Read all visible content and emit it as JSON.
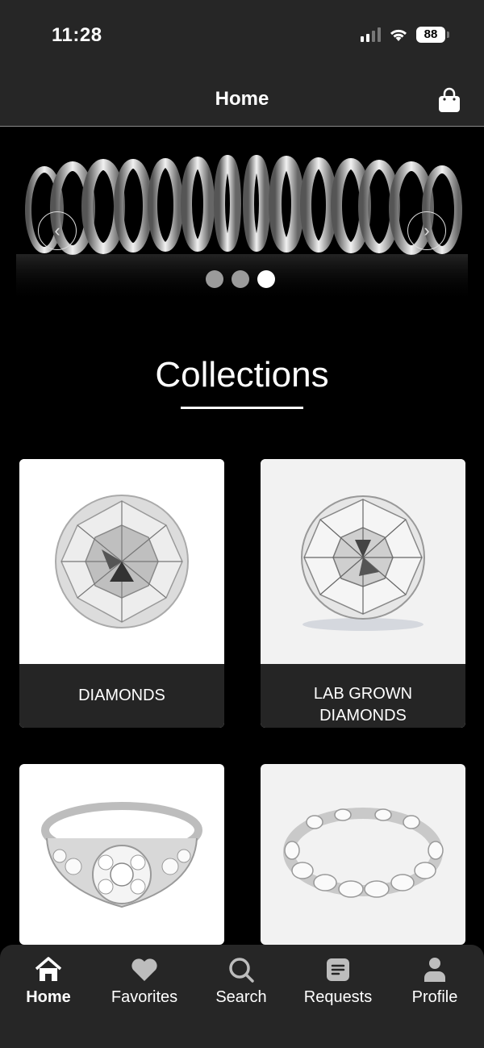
{
  "status_bar": {
    "time": "11:28",
    "battery": "88"
  },
  "header": {
    "title": "Home"
  },
  "banner": {
    "slide_count": 3,
    "active_slide": 3
  },
  "collections": {
    "title": "Collections",
    "items": [
      {
        "label": "DIAMONDS",
        "icon": "round-diamond"
      },
      {
        "label": "LAB GROWN DIAMONDS",
        "icon": "round-diamond"
      },
      {
        "label": "",
        "icon": "halo-engagement-ring"
      },
      {
        "label": "",
        "icon": "eternity-band"
      }
    ]
  },
  "tabbar": {
    "items": [
      {
        "label": "Home",
        "icon": "home-icon",
        "active": true
      },
      {
        "label": "Favorites",
        "icon": "heart-icon",
        "active": false
      },
      {
        "label": "Search",
        "icon": "search-icon",
        "active": false
      },
      {
        "label": "Requests",
        "icon": "requests-icon",
        "active": false
      },
      {
        "label": "Profile",
        "icon": "profile-icon",
        "active": false
      }
    ]
  },
  "colors": {
    "background": "#000000",
    "surface": "#262626",
    "card_label": "#252525",
    "accent": "#ffffff"
  }
}
